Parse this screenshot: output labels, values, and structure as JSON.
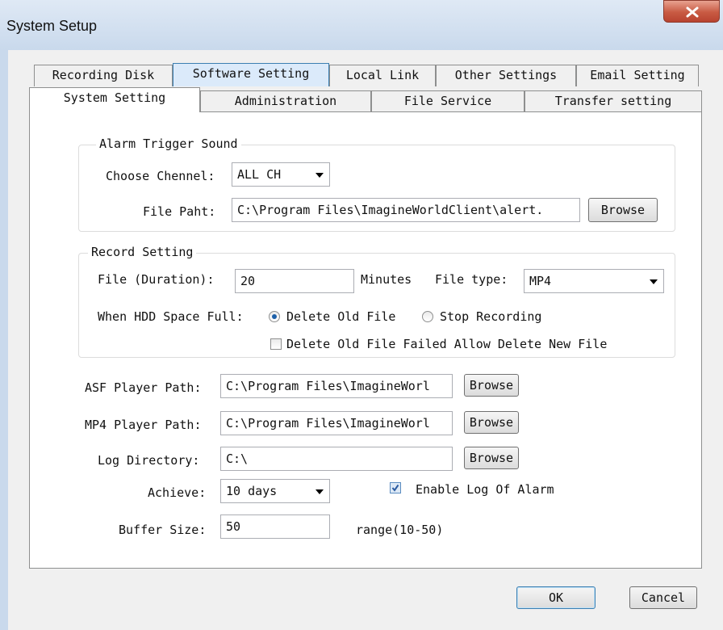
{
  "window": {
    "title": "System Setup"
  },
  "tabs_row1": [
    "Recording Disk",
    "Software Setting",
    "Local Link",
    "Other Settings",
    "Email Setting"
  ],
  "tabs_row2": [
    "System Setting",
    "Administration",
    "File Service",
    "Transfer setting"
  ],
  "alarm_group": {
    "title": "Alarm Trigger Sound",
    "channel_label": "Choose Chennel:",
    "channel_value": "ALL CH",
    "file_label": "File Paht:",
    "file_value": "C:\\Program Files\\ImagineWorldClient\\alert.",
    "browse": "Browse"
  },
  "record_group": {
    "title": "Record Setting",
    "duration_label": "File (Duration):",
    "duration_value": "20",
    "minutes": "Minutes",
    "filetype_label": "File type:",
    "filetype_value": "MP4",
    "hdd_label": "When HDD Space Full:",
    "delete_old": "Delete Old File",
    "stop_recording": "Stop Recording",
    "delete_new": "Delete Old File Failed Allow Delete New File"
  },
  "asf_label": "ASF Player Path:",
  "asf_value": "C:\\Program Files\\ImagineWorl",
  "mp4_label": "MP4 Player Path:",
  "mp4_value": "C:\\Program Files\\ImagineWorl",
  "log_label": "Log Directory:",
  "log_value": "C:\\",
  "browse": "Browse",
  "achieve_label": "Achieve:",
  "achieve_value": "10 days",
  "enable_log": "Enable Log Of Alarm",
  "buffer_label": "Buffer Size:",
  "buffer_value": "50",
  "buffer_range": "range(10-50)",
  "ok": "OK",
  "cancel": "Cancel",
  "colors": {
    "accent": "#3c7fb1",
    "close": "#c85a43",
    "title_bar": "#dfe9f5"
  },
  "icons": {
    "close": "close-icon",
    "radio_selected": "radio-selected-icon",
    "checkbox_checked": "checkmark-icon"
  }
}
